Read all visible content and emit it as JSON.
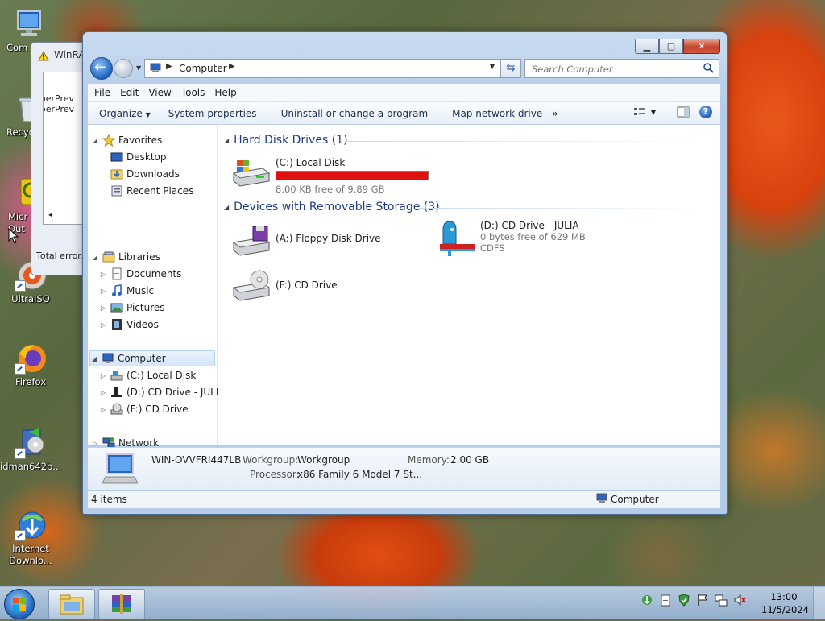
{
  "desktop": {
    "icons": [
      {
        "label": "Com"
      },
      {
        "label": "Recyc"
      },
      {
        "label": "Micr\nOut"
      },
      {
        "label": "UltraISO"
      },
      {
        "label": "Firefox"
      },
      {
        "label": "idman642b..."
      },
      {
        "label": "Internet\nDownlo..."
      }
    ]
  },
  "winrar": {
    "title": "WinRA",
    "lines": [
      "loperPrev",
      "loperPrev"
    ],
    "status": "Total errors"
  },
  "window": {
    "address": {
      "location": "Computer"
    },
    "search": {
      "placeholder": "Search Computer"
    },
    "menu": [
      "File",
      "Edit",
      "View",
      "Tools",
      "Help"
    ],
    "toolbar": {
      "organize": "Organize",
      "system_properties": "System properties",
      "uninstall": "Uninstall or change a program",
      "map_network": "Map network drive",
      "more": "»"
    },
    "nav": {
      "favorites": "Favorites",
      "desktop": "Desktop",
      "downloads": "Downloads",
      "recent": "Recent Places",
      "libraries": "Libraries",
      "documents": "Documents",
      "music": "Music",
      "pictures": "Pictures",
      "videos": "Videos",
      "computer": "Computer",
      "local_disk": "(C:) Local Disk",
      "cd_julia": "(D:) CD Drive - JULIA",
      "cd_f": "(F:) CD Drive",
      "network": "Network"
    },
    "content": {
      "hdd_group": "Hard Disk Drives (1)",
      "removable_group": "Devices with Removable Storage (3)",
      "c_name": "(C:) Local Disk",
      "c_free": "8.00 KB free of 9.89 GB",
      "c_used_fraction": 0.999,
      "a_name": "(A:) Floppy Disk Drive",
      "d_name": "(D:) CD Drive - JULIA",
      "d_free": "0 bytes free of 629 MB",
      "d_fs": "CDFS",
      "f_name": "(F:) CD Drive"
    },
    "details": {
      "computer_name": "WIN-OVVFRI447LB",
      "workgroup_label": "Workgroup:",
      "workgroup_value": "Workgroup",
      "memory_label": "Memory:",
      "memory_value": "2.00 GB",
      "processor_label": "Processor:",
      "processor_value": "x86 Family 6 Model 7 St..."
    },
    "status": {
      "items": "4 items",
      "location": "Computer"
    }
  },
  "taskbar": {
    "clock_time": "13:00",
    "clock_date": "11/5/2024"
  }
}
